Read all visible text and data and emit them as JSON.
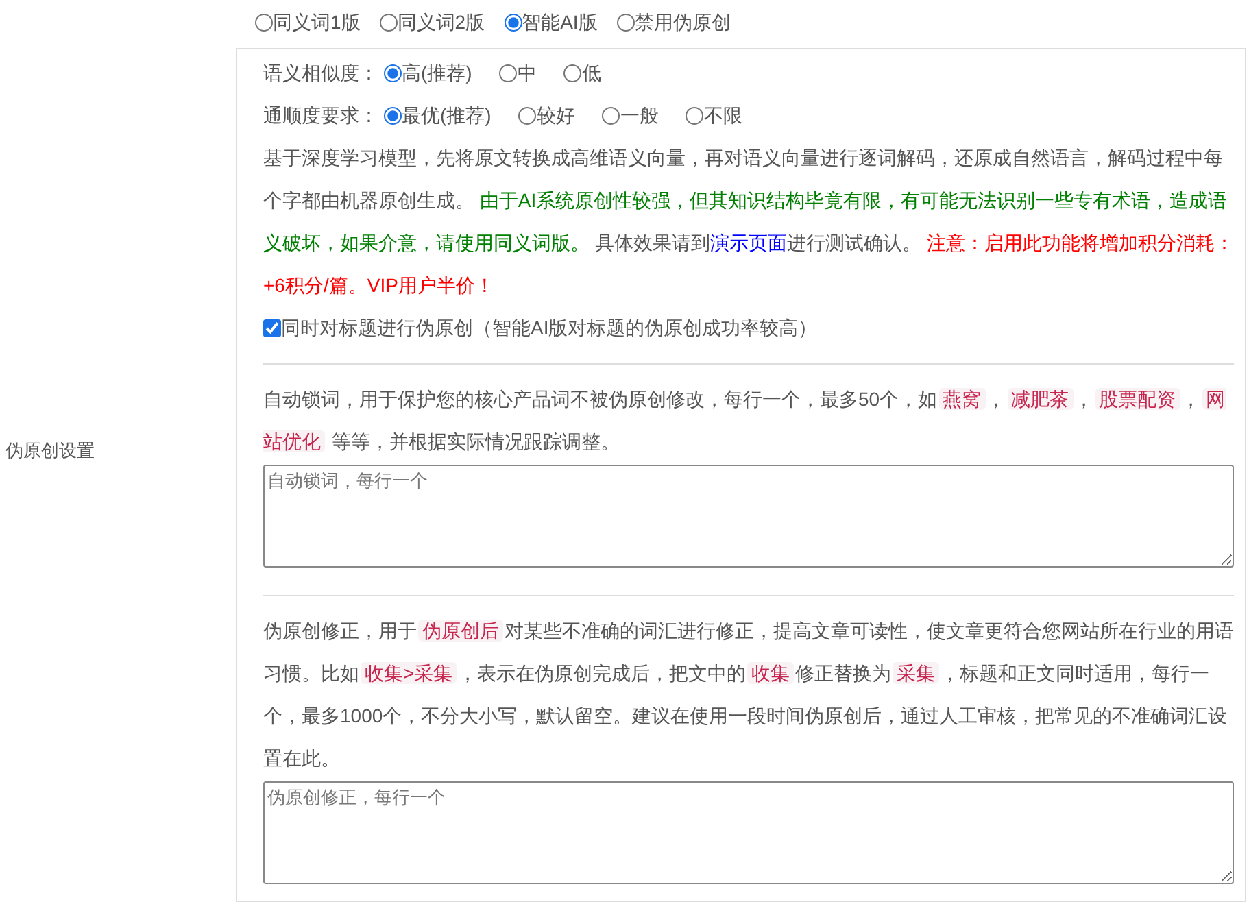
{
  "section_label": "伪原创设置",
  "modes": [
    {
      "label": "同义词1版",
      "selected": false
    },
    {
      "label": "同义词2版",
      "selected": false
    },
    {
      "label": "智能AI版",
      "selected": true
    },
    {
      "label": "禁用伪原创",
      "selected": false
    }
  ],
  "settings": [
    {
      "label": "语义相似度：",
      "options": [
        {
          "label": "高(推荐)",
          "selected": true
        },
        {
          "label": "中",
          "selected": false
        },
        {
          "label": "低",
          "selected": false
        }
      ]
    },
    {
      "label": "通顺度要求：",
      "options": [
        {
          "label": "最优(推荐)",
          "selected": true
        },
        {
          "label": "较好",
          "selected": false
        },
        {
          "label": "一般",
          "selected": false
        },
        {
          "label": "不限",
          "selected": false
        }
      ]
    }
  ],
  "description": [
    {
      "kind": "text",
      "text": "基于深度学习模型，先将原文转换成高维语义向量，再对语义向量进行逐词解码，还原成自然语言，解码过程中每个字都由机器原创生成。 "
    },
    {
      "kind": "note",
      "text": "由于AI系统原创性较强，但其知识结构毕竟有限，有可能无法识别一些专有术语，造成语义破坏，如果介意，请使用同义词版。"
    },
    {
      "kind": "text",
      "text": " 具体效果请到"
    },
    {
      "kind": "link",
      "text": "演示页面"
    },
    {
      "kind": "text",
      "text": "进行测试确认。 "
    },
    {
      "kind": "warning",
      "text": "注意：启用此功能将增加积分消耗：+6积分/篇。VIP用户半价！"
    }
  ],
  "title_option": {
    "label": "同时对标题进行伪原创（智能AI版对标题的伪原创成功率较高）",
    "checked": true
  },
  "sections": [
    {
      "paragraph": [
        {
          "kind": "text",
          "text": "自动锁词，用于保护您的核心产品词不被伪原创修改，每行一个，最多50个，如"
        },
        {
          "kind": "tag",
          "text": "燕窝"
        },
        {
          "kind": "text",
          "text": "，"
        },
        {
          "kind": "tag",
          "text": "减肥茶"
        },
        {
          "kind": "text",
          "text": "，"
        },
        {
          "kind": "tag",
          "text": "股票配资"
        },
        {
          "kind": "text",
          "text": "，"
        },
        {
          "kind": "tag",
          "text": "网站优化"
        },
        {
          "kind": "text",
          "text": " 等等，并根据实际情况跟踪调整。"
        }
      ],
      "placeholder": "自动锁词，每行一个"
    },
    {
      "paragraph": [
        {
          "kind": "text",
          "text": "伪原创修正，用于"
        },
        {
          "kind": "tag",
          "text": "伪原创后"
        },
        {
          "kind": "text",
          "text": "对某些不准确的词汇进行修正，提高文章可读性，使文章更符合您网站所在行业的用语习惯。比如"
        },
        {
          "kind": "tag",
          "text": "收集>采集"
        },
        {
          "kind": "text",
          "text": "，表示在伪原创完成后，把文中的"
        },
        {
          "kind": "tag",
          "text": "收集"
        },
        {
          "kind": "text",
          "text": "修正替换为"
        },
        {
          "kind": "tag",
          "text": "采集"
        },
        {
          "kind": "text",
          "text": "，标题和正文同时适用，每行一个，最多1000个，不分大小写，默认留空。建议在使用一段时间伪原创后，通过人工审核，把常见的不准确词汇设置在此。"
        }
      ],
      "placeholder": "伪原创修正，每行一个"
    }
  ]
}
